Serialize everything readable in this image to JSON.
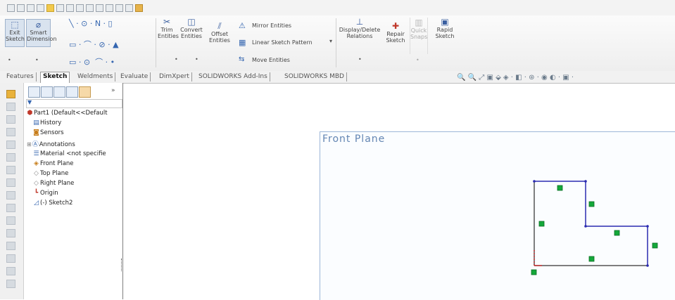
{
  "ribbon": {
    "exit_sketch": "Exit Sketch",
    "smart_dimension": "Smart Dimension",
    "trim_entities": "Trim Entities",
    "convert_entities": "Convert Entities",
    "offset_entities": "Offset Entities",
    "mirror_entities": "Mirror Entities",
    "linear_sketch_pattern": "Linear Sketch Pattern",
    "move_entities": "Move Entities",
    "display_delete_relations": "Display/Delete Relations",
    "repair_sketch": "Repair Sketch",
    "quick_snaps": "Quick Snaps",
    "rapid_sketch": "Rapid Sketch"
  },
  "tabs": [
    "Features",
    "Sketch",
    "Weldments",
    "Evaluate",
    "DimXpert",
    "SOLIDWORKS Add-Ins",
    "SOLIDWORKS MBD"
  ],
  "active_tab": "Sketch",
  "tree": {
    "root": "Part1  (Default<<Default",
    "items": [
      {
        "label": "History",
        "icon": "history-icon"
      },
      {
        "label": "Sensors",
        "icon": "sensors-icon"
      },
      {
        "label": "Annotations",
        "icon": "annotations-icon"
      },
      {
        "label": "Material <not specifie",
        "icon": "material-icon"
      },
      {
        "label": "Front Plane",
        "icon": "plane-icon"
      },
      {
        "label": "Top Plane",
        "icon": "plane-icon"
      },
      {
        "label": "Right Plane",
        "icon": "plane-icon"
      },
      {
        "label": "Origin",
        "icon": "origin-icon"
      },
      {
        "label": "(-) Sketch2",
        "icon": "sketch-icon"
      }
    ]
  },
  "viewport": {
    "plane_label": "Front Plane"
  },
  "colors": {
    "sketch_line": "#2b2bb0",
    "relation_marker": "#14a83a",
    "origin": "#d21a1a",
    "plane_border": "#9db6d8"
  }
}
